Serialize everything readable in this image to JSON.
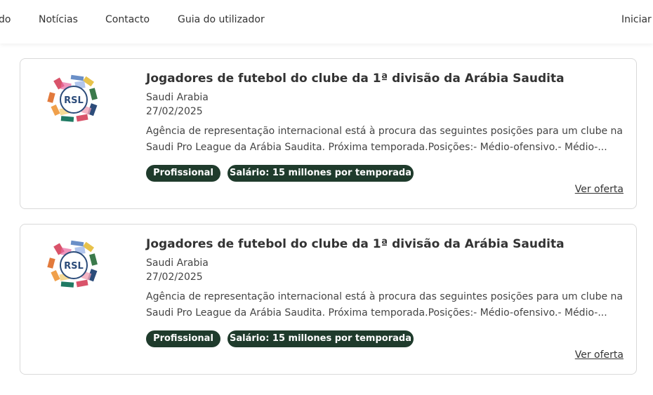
{
  "nav": {
    "items": [
      "do",
      "Notícias",
      "Contacto",
      "Guia do utilizador",
      "Iniciar s"
    ]
  },
  "offers": [
    {
      "logo_text": "RSL",
      "title": "Jogadores de futebol do clube da 1ª divisão da Arábia Saudita",
      "location": "Saudi Arabia",
      "date": "27/02/2025",
      "description": "Agência de representação internacional está à procura das seguintes posições para um clube na Saudi Pro League da Arábia Saudita. Próxima temporada.Posições:- Médio-ofensivo.- Médio-...",
      "badges": [
        "Profissional",
        "Salário: 15 millones por temporada"
      ],
      "link": "Ver oferta"
    },
    {
      "logo_text": "RSL",
      "title": "Jogadores de futebol do clube da 1ª divisão da Arábia Saudita",
      "location": "Saudi Arabia",
      "date": "27/02/2025",
      "description": "Agência de representação internacional está à procura das seguintes posições para um clube na Saudi Pro League da Arábia Saudita. Próxima temporada.Posições:- Médio-ofensivo.- Médio-...",
      "badges": [
        "Profissional",
        "Salário: 15 millones por temporada"
      ],
      "link": "Ver oferta"
    }
  ],
  "colors": {
    "badge_bg": "#1f3b2c",
    "border": "#d9d9d9",
    "text": "#333333"
  }
}
